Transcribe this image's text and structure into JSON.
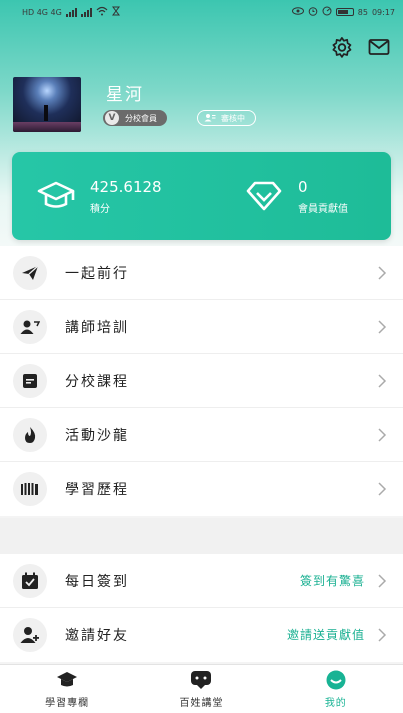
{
  "status_bar": {
    "left_text": "HD 4G 4G",
    "time": "09:17",
    "battery": "85"
  },
  "profile": {
    "name": "星河",
    "member_badge": "分校會員",
    "member_badge_icon": "V",
    "review_badge": "審核中"
  },
  "stats": {
    "points_value": "425.6128",
    "points_label": "積分",
    "contribution_value": "0",
    "contribution_label": "會員貢獻值"
  },
  "menu": [
    {
      "label": "一起前行",
      "icon": "paper-plane-icon"
    },
    {
      "label": "講師培訓",
      "icon": "teacher-icon"
    },
    {
      "label": "分校課程",
      "icon": "message-box-icon"
    },
    {
      "label": "活動沙龍",
      "icon": "flame-icon"
    },
    {
      "label": "學習歷程",
      "icon": "barcode-icon"
    }
  ],
  "menu2": [
    {
      "label": "每日簽到",
      "extra": "簽到有驚喜",
      "icon": "calendar-check-icon"
    },
    {
      "label": "邀請好友",
      "extra": "邀請送貢獻值",
      "icon": "add-user-icon"
    }
  ],
  "tabs": [
    {
      "label": "學習專欄",
      "icon": "graduation-cap-icon",
      "active": false
    },
    {
      "label": "百姓講堂",
      "icon": "chat-bubble-icon",
      "active": false
    },
    {
      "label": "我的",
      "icon": "smile-icon",
      "active": true
    }
  ],
  "colors": {
    "accent": "#1ebc98",
    "active_tab": "#18b394",
    "card_start": "#26c6a7"
  }
}
